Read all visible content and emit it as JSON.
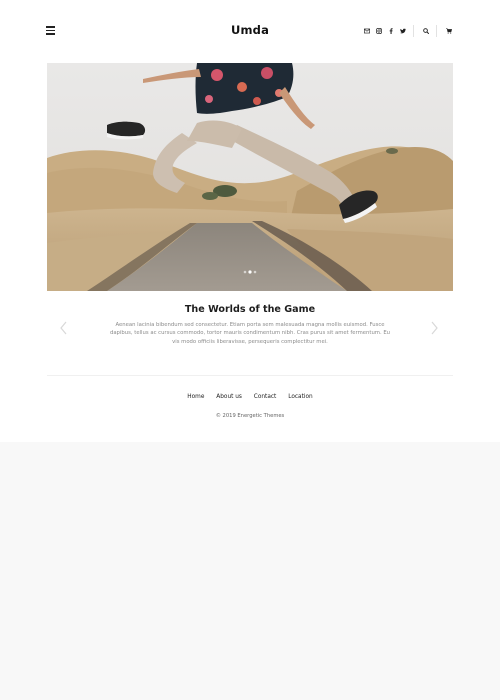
{
  "header": {
    "logo": "Umda",
    "menu_icon": "hamburger-menu-icon",
    "icons": [
      "envelope-icon",
      "instagram-icon",
      "facebook-icon",
      "twitter-icon",
      "search-icon",
      "cart-icon"
    ]
  },
  "hero": {
    "image": "man-jumping-on-country-road-photo",
    "slide_count": 3,
    "active_slide": 2
  },
  "slide": {
    "title": "The Worlds of the Game",
    "text": "Aenean lacinia bibendum sed consectetur. Etiam porta sem malesuada magna mollis euismod. Fusce dapibus, tellus ac cursus commodo, tortor mauris condimentum nibh. Cras purus sit amet fermentum. Eu vis modo officiis liberavisse, persequeris complectitur mei."
  },
  "footer": {
    "nav": [
      "Home",
      "About us",
      "Contact",
      "Location"
    ],
    "copyright": "© 2019 Energetic Themes"
  },
  "colors": {
    "background": "#f8f8f8",
    "page": "#ffffff",
    "text": "#222222",
    "muted": "#8a8a8a"
  }
}
